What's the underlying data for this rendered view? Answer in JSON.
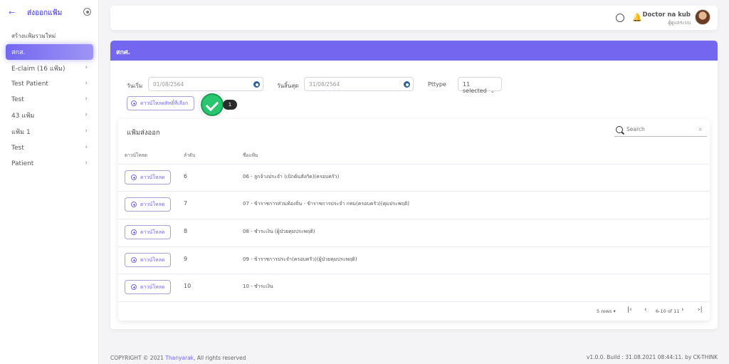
{
  "sidebar": {
    "back_icon": "arrow-left-icon",
    "title": "ส่งออกแฟ้ม",
    "create_label": "สร้างแฟ้มรวมใหม่",
    "items": [
      {
        "label": "สกส.",
        "active": true
      },
      {
        "label": "E-claim (16 แฟ้ม)"
      },
      {
        "label": "Test Patient"
      },
      {
        "label": "Test"
      },
      {
        "label": "43 แฟ้ม"
      },
      {
        "label": "แฟ้ม 1"
      },
      {
        "label": "Test"
      },
      {
        "label": "Patient"
      }
    ]
  },
  "navbar": {
    "user_name": "Doctor na kub",
    "user_role": "ผู้ดูแลระบบ"
  },
  "main": {
    "header": "สกศ.",
    "start_label": "วันเริ่ม",
    "start_value": "01/08/2564",
    "end_label": "วันสิ้นสุด",
    "end_value": "31/08/2564",
    "pttype_label": "Pttype",
    "pttype_value": "11 selected",
    "download_selected_label": "ดาวน์โหลดสิทธิ์ที่เลือก",
    "step_number": "1"
  },
  "table": {
    "title": "แฟ้มส่งออก",
    "search_placeholder": "Search",
    "columns": [
      "ดาวน์โหลด",
      "ลำดับ",
      "ชื่อแฟ้ม"
    ],
    "download_label": "ดาวน์โหลด",
    "rows": [
      {
        "num": "6",
        "name": "06 - ลูกจ้างประจำ (เบิกต้นสังกัด)(ครอบครัว)"
      },
      {
        "num": "7",
        "name": "07 - ข้าราชการส่วนท้องถิ่น - ข้าราชการประจำ กทม(ครอบครัว)(คุมประพฤติ)"
      },
      {
        "num": "8",
        "name": "08 - ชำระเงิน (ผู้ป่วยคุมประพฤติ)"
      },
      {
        "num": "9",
        "name": "09 - ข้าราชการประจำ(ครอบครัว)(ผู้ป่วยคุมประพฤติ)"
      },
      {
        "num": "10",
        "name": "10 - ชำระเงิน"
      }
    ],
    "rows_per_page": "5 rows",
    "page_info": "6-10 of 11"
  },
  "footer": {
    "copyright_prefix": "COPYRIGHT © 2021 ",
    "brand": "Thanyarak",
    "copyright_suffix": ", All rights reserved",
    "version": "v1.0.0. Build : 31.08.2021 08:44:11. by CK-THINK"
  },
  "colors": {
    "accent": "#7367f0",
    "success": "#28c76f"
  }
}
